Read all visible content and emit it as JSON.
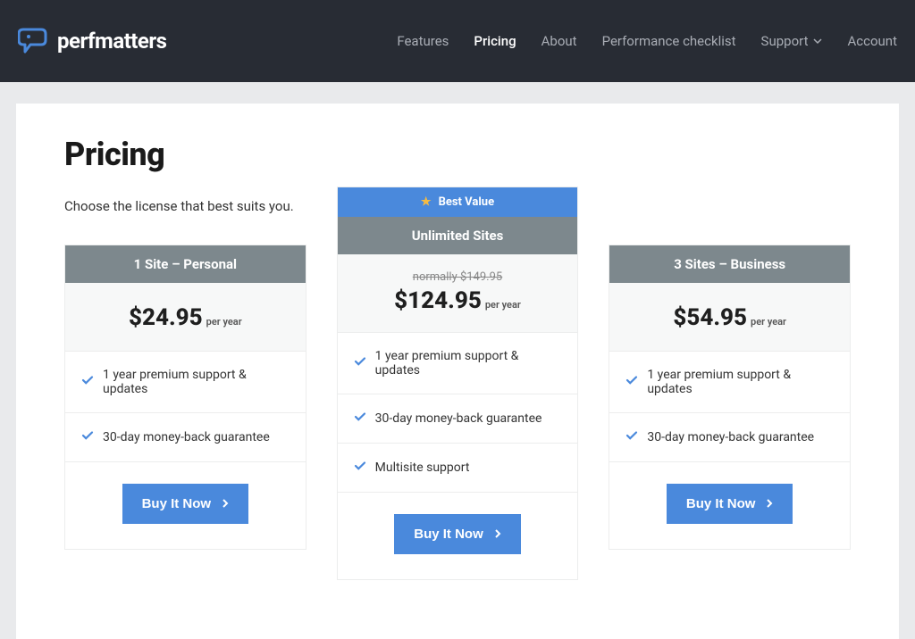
{
  "brand": {
    "name": "perfmatters"
  },
  "nav": {
    "features": "Features",
    "pricing": "Pricing",
    "about": "About",
    "checklist": "Performance checklist",
    "support": "Support",
    "account": "Account"
  },
  "page": {
    "title": "Pricing",
    "subtitle": "Choose the license that best suits you."
  },
  "featured_badge": "Best Value",
  "plans": {
    "personal": {
      "title": "1 Site – Personal",
      "price": "$24.95",
      "per": "per year",
      "buy": "Buy It Now",
      "features": [
        "1 year premium support & updates",
        "30-day money-back guarantee"
      ]
    },
    "unlimited": {
      "title": "Unlimited Sites",
      "strike": "normally $149.95",
      "price": "$124.95",
      "per": "per year",
      "buy": "Buy It Now",
      "features": [
        "1 year premium support & updates",
        "30-day money-back guarantee",
        "Multisite support"
      ]
    },
    "business": {
      "title": "3 Sites – Business",
      "price": "$54.95",
      "per": "per year",
      "buy": "Buy It Now",
      "features": [
        "1 year premium support & updates",
        "30-day money-back guarantee"
      ]
    }
  }
}
